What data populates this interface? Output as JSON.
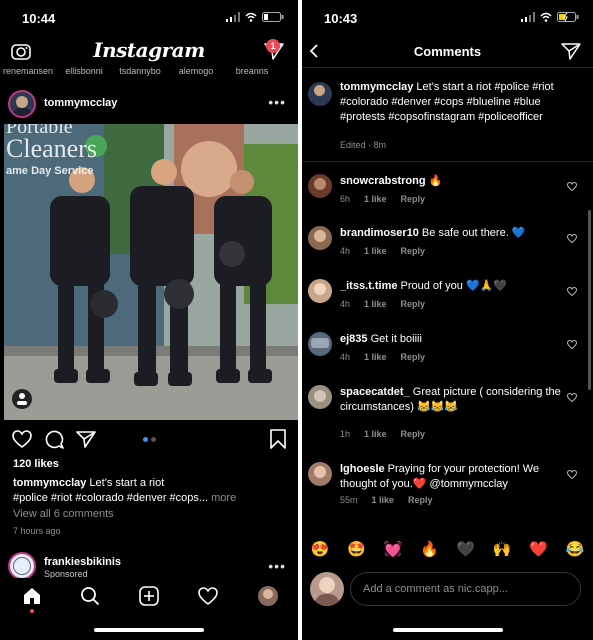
{
  "left": {
    "status_time": "10:44",
    "app_title": "Instagram",
    "dm_badge": "1",
    "stories": [
      "renemansen",
      "ellisbonni",
      "tsdannybo",
      "alemogo",
      "breanns"
    ],
    "post": {
      "username": "tommymcclay",
      "likes": "120 likes",
      "caption_user": "tommymcclay",
      "caption_text": " Let's start a riot",
      "caption_tags": "#police #riot #colorado #denver #cops...",
      "caption_more": " more",
      "view_all": "View all 6 comments",
      "time_ago": "7 hours ago",
      "image_sign_line1": "Portable",
      "image_sign_line2": "Cleaners",
      "image_sign_line3": "ame Day Service"
    },
    "next_post": {
      "username": "frankiesbikinis",
      "sponsored": "Sponsored"
    },
    "tabs": [
      "home-icon",
      "search-icon",
      "add-post-icon",
      "activity-heart-icon",
      "profile-avatar"
    ]
  },
  "right": {
    "status_time": "10:43",
    "title": "Comments",
    "original": {
      "username": "tommymcclay",
      "text": " Let's start a riot #police #riot #colorado #denver #cops #blueline #blue #protests #copsofinstagram #policeofficer",
      "meta": "Edited · 8m"
    },
    "comments": [
      {
        "username": "snowcrabstrong",
        "text": " 🔥",
        "time": "6h",
        "likes": "1 like",
        "reply": "Reply"
      },
      {
        "username": "brandimoser10",
        "text": " Be safe out there. 💙",
        "time": "4h",
        "likes": "1 like",
        "reply": "Reply"
      },
      {
        "username": "_itss.t.time",
        "text": " Proud of you 💙🙏🖤",
        "time": "4h",
        "likes": "1 like",
        "reply": "Reply"
      },
      {
        "username": "ej835",
        "text": " Get it boiiii",
        "time": "4h",
        "likes": "1 like",
        "reply": "Reply"
      },
      {
        "username": "spacecatdet_",
        "text": " Great picture ( considering the circumstances) 😹😹😹",
        "time": "1h",
        "likes": "1 like",
        "reply": "Reply"
      },
      {
        "username": "lghoesle",
        "text": " Praying for your protection! We thought of you.❤️ @tommymcclay",
        "time": "55m",
        "likes": "1 like",
        "reply": "Reply"
      }
    ],
    "emojis": [
      "😍",
      "🤩",
      "💓",
      "🔥",
      "🖤",
      "🙌",
      "❤️",
      "😂"
    ],
    "add_comment_placeholder": "Add a comment as nic.capp..."
  },
  "colors": {
    "background": "#000000",
    "muted": "#8e8e8e",
    "badge": "#ed4956",
    "divider": "#262626"
  }
}
